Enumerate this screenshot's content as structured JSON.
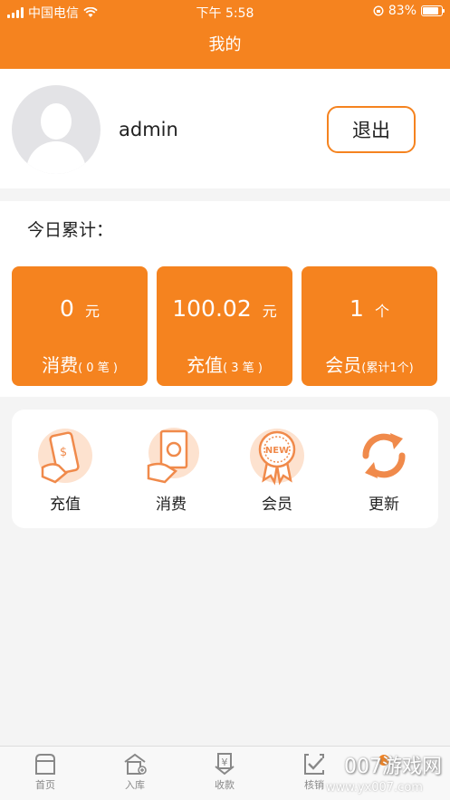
{
  "status_bar": {
    "carrier": "中国电信",
    "time": "下午 5:58",
    "battery": "83%",
    "battery_level": 0.83
  },
  "header": {
    "title": "我的"
  },
  "profile": {
    "username": "admin",
    "logout_label": "退出"
  },
  "today": {
    "label": "今日累计："
  },
  "stats": [
    {
      "value": "0",
      "unit": "元",
      "label": "消费",
      "detail": "( 0 笔 )"
    },
    {
      "value": "100.02",
      "unit": "元",
      "label": "充值",
      "detail": "( 3 笔 )"
    },
    {
      "value": "1",
      "unit": "个",
      "label": "会员",
      "detail": "(累计1个)"
    }
  ],
  "actions": [
    {
      "label": "充值",
      "icon": "phone-payment-icon"
    },
    {
      "label": "消费",
      "icon": "cash-payment-icon"
    },
    {
      "label": "会员",
      "icon": "new-badge-icon"
    },
    {
      "label": "更新",
      "icon": "refresh-icon"
    }
  ],
  "tabs": [
    {
      "label": "首页",
      "icon": "home-icon"
    },
    {
      "label": "入库",
      "icon": "warehouse-in-icon"
    },
    {
      "label": "收款",
      "icon": "yuan-receive-icon"
    },
    {
      "label": "核销",
      "icon": "check-icon"
    }
  ],
  "watermark": {
    "text": "007游戏网",
    "url": "www.yx007.com"
  },
  "colors": {
    "accent": "#f5831f",
    "background": "#f4f4f4"
  }
}
